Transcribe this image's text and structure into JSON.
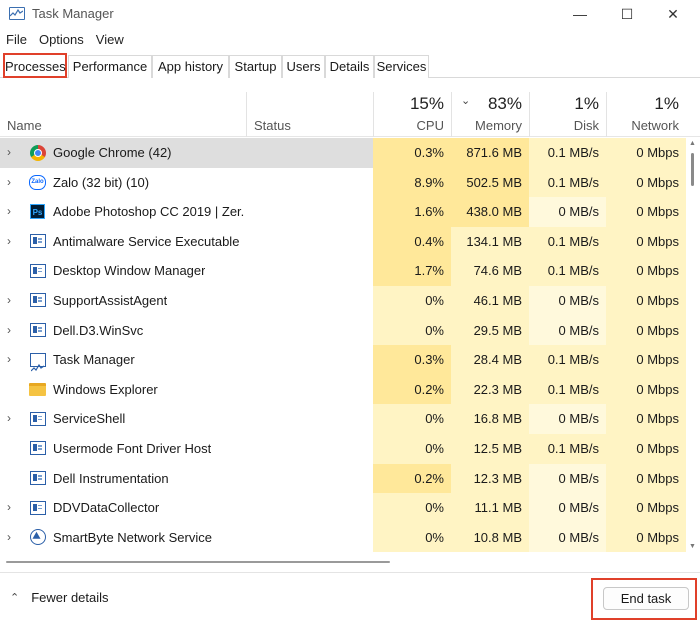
{
  "window": {
    "title": "Task Manager",
    "controls": {
      "minimize": "—",
      "maximize": "☐",
      "close": "✕"
    }
  },
  "menu": [
    "File",
    "Options",
    "View"
  ],
  "tabs": [
    "Processes",
    "Performance",
    "App history",
    "Startup",
    "Users",
    "Details",
    "Services"
  ],
  "active_tab": "Processes",
  "columns": {
    "name": "Name",
    "status": "Status",
    "cpu": {
      "percent": "15%",
      "label": "CPU"
    },
    "memory": {
      "percent": "83%",
      "label": "Memory",
      "sort_icon": "chevron-down-icon"
    },
    "disk": {
      "percent": "1%",
      "label": "Disk"
    },
    "network": {
      "percent": "1%",
      "label": "Network"
    }
  },
  "processes": [
    {
      "name": "Google Chrome (42)",
      "icon": "chrome-icon",
      "expandable": true,
      "cpu": "0.3%",
      "memory": "871.6 MB",
      "disk": "0.1 MB/s",
      "network": "0 Mbps"
    },
    {
      "name": "Zalo (32 bit) (10)",
      "icon": "zalo-icon",
      "icon_text": "Zalo",
      "expandable": true,
      "cpu": "8.9%",
      "memory": "502.5 MB",
      "disk": "0.1 MB/s",
      "network": "0 Mbps"
    },
    {
      "name": "Adobe Photoshop CC 2019 | Zer...",
      "icon": "photoshop-icon",
      "icon_text": "Ps",
      "expandable": true,
      "cpu": "1.6%",
      "memory": "438.0 MB",
      "disk": "0 MB/s",
      "network": "0 Mbps"
    },
    {
      "name": "Antimalware Service Executable",
      "icon": "service-window-icon",
      "expandable": true,
      "cpu": "0.4%",
      "memory": "134.1 MB",
      "disk": "0.1 MB/s",
      "network": "0 Mbps"
    },
    {
      "name": "Desktop Window Manager",
      "icon": "service-window-icon",
      "expandable": false,
      "cpu": "1.7%",
      "memory": "74.6 MB",
      "disk": "0.1 MB/s",
      "network": "0 Mbps"
    },
    {
      "name": "SupportAssistAgent",
      "icon": "service-window-icon",
      "expandable": true,
      "cpu": "0%",
      "memory": "46.1 MB",
      "disk": "0 MB/s",
      "network": "0 Mbps"
    },
    {
      "name": "Dell.D3.WinSvc",
      "icon": "service-window-icon",
      "expandable": true,
      "cpu": "0%",
      "memory": "29.5 MB",
      "disk": "0 MB/s",
      "network": "0 Mbps"
    },
    {
      "name": "Task Manager",
      "icon": "task-manager-icon",
      "expandable": true,
      "cpu": "0.3%",
      "memory": "28.4 MB",
      "disk": "0.1 MB/s",
      "network": "0 Mbps"
    },
    {
      "name": "Windows Explorer",
      "icon": "folder-icon",
      "expandable": false,
      "cpu": "0.2%",
      "memory": "22.3 MB",
      "disk": "0.1 MB/s",
      "network": "0 Mbps"
    },
    {
      "name": "ServiceShell",
      "icon": "service-window-icon",
      "expandable": true,
      "cpu": "0%",
      "memory": "16.8 MB",
      "disk": "0 MB/s",
      "network": "0 Mbps"
    },
    {
      "name": "Usermode Font Driver Host",
      "icon": "service-window-icon",
      "expandable": false,
      "cpu": "0%",
      "memory": "12.5 MB",
      "disk": "0.1 MB/s",
      "network": "0 Mbps"
    },
    {
      "name": "Dell Instrumentation",
      "icon": "service-window-icon",
      "expandable": false,
      "cpu": "0.2%",
      "memory": "12.3 MB",
      "disk": "0 MB/s",
      "network": "0 Mbps"
    },
    {
      "name": "DDVDataCollector",
      "icon": "service-window-icon",
      "expandable": true,
      "cpu": "0%",
      "memory": "11.1 MB",
      "disk": "0 MB/s",
      "network": "0 Mbps"
    },
    {
      "name": "SmartByte Network Service",
      "icon": "smartbyte-icon",
      "expandable": true,
      "cpu": "0%",
      "memory": "10.8 MB",
      "disk": "0 MB/s",
      "network": "0 Mbps"
    }
  ],
  "footer": {
    "fewer_details": "Fewer details",
    "end_task": "End task"
  },
  "colors": {
    "highlight_outline": "#e0402a",
    "heat_low": "#fff4c4",
    "heat_mid": "#ffe89a",
    "selected_row": "#dedede"
  }
}
